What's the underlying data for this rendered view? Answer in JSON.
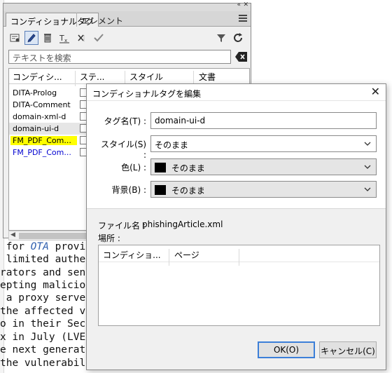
{
  "document": {
    "lines": [
      " for OTA provis",
      " limited authent",
      "rators and send c",
      "epting malicious",
      " a proxy server",
      "the affected ve",
      "o in their Secur",
      "x in July (LVE-S",
      "e next generatio",
      "the vulnerability"
    ],
    "emph_word": "OTA"
  },
  "panel": {
    "tabs": [
      "コンディショナルタグ",
      "エレメント"
    ],
    "search_placeholder": "テキストを検索",
    "columns": [
      "コンディシ...",
      "ステ...",
      "スタイル",
      "文書"
    ],
    "rows": [
      {
        "name": "DITA-Prolog"
      },
      {
        "name": "DITA-Comment"
      },
      {
        "name": "domain-xml-d"
      },
      {
        "name": "domain-ui-d"
      },
      {
        "name": "FM_PDF_Com..."
      },
      {
        "name": "FM_PDF_Com..."
      }
    ],
    "toolbar_icons": [
      "new-tag-icon",
      "edit-pencil-icon",
      "delete-icon",
      "text-format-icon",
      "remove-tag-icon",
      "apply-check-icon",
      "filter-icon",
      "refresh-icon"
    ]
  },
  "dialog": {
    "title": "コンディショナルタグを編集",
    "tag_name_label": "タグ名(T) :",
    "tag_name_value": "domain-ui-d",
    "style_label": "スタイル(S) :",
    "style_value": "そのまま",
    "color_label": "色(L) :",
    "color_value": "そのまま",
    "background_label": "背景(B) :",
    "background_value": "そのまま",
    "filename_label": "ファイル名 :",
    "filename_value": "phishingArticle.xml",
    "location_label": "場所 :",
    "location_columns": [
      "コンディショ...",
      "ページ"
    ],
    "ok_label": "OK(O)",
    "cancel_label": "キャンセル(C)"
  },
  "colors": {
    "highlight": "#ffff00",
    "blue_tag": "#0000d0",
    "default_button_border": "#3c7fd8"
  }
}
